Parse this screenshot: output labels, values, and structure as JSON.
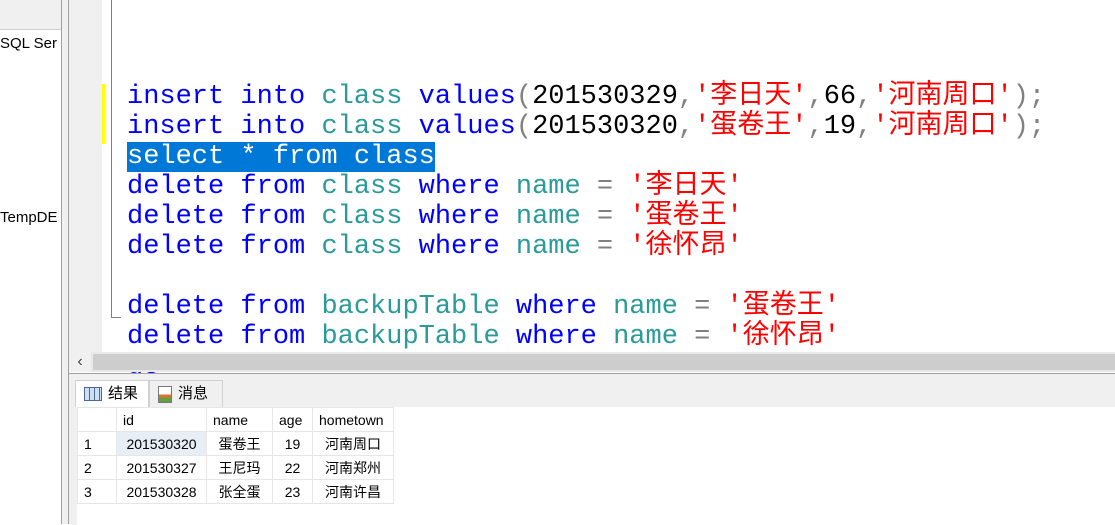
{
  "object_explorer": {
    "nodes": [
      "SQL Ser",
      "TempDE"
    ]
  },
  "editor": {
    "lines": [
      [],
      [
        {
          "t": "insert",
          "c": "kw"
        },
        {
          "t": " "
        },
        {
          "t": "into",
          "c": "kw"
        },
        {
          "t": " "
        },
        {
          "t": "class",
          "c": "id"
        },
        {
          "t": " "
        },
        {
          "t": "values",
          "c": "kw"
        },
        {
          "t": "(",
          "c": "pu"
        },
        {
          "t": "201530329",
          "c": "nu"
        },
        {
          "t": ",",
          "c": "pu"
        },
        {
          "t": "'李日天'",
          "c": "st"
        },
        {
          "t": ",",
          "c": "pu"
        },
        {
          "t": "66",
          "c": "nu"
        },
        {
          "t": ",",
          "c": "pu"
        },
        {
          "t": "'河南周口'",
          "c": "st"
        },
        {
          "t": ");",
          "c": "pu"
        }
      ],
      [
        {
          "t": "insert",
          "c": "kw"
        },
        {
          "t": " "
        },
        {
          "t": "into",
          "c": "kw"
        },
        {
          "t": " "
        },
        {
          "t": "class",
          "c": "id"
        },
        {
          "t": " "
        },
        {
          "t": "values",
          "c": "kw"
        },
        {
          "t": "(",
          "c": "pu"
        },
        {
          "t": "201530320",
          "c": "nu"
        },
        {
          "t": ",",
          "c": "pu"
        },
        {
          "t": "'蛋卷王'",
          "c": "st"
        },
        {
          "t": ",",
          "c": "pu"
        },
        {
          "t": "19",
          "c": "nu"
        },
        {
          "t": ",",
          "c": "pu"
        },
        {
          "t": "'河南周口'",
          "c": "st"
        },
        {
          "t": ");",
          "c": "pu"
        }
      ],
      [
        {
          "t": "select * from class",
          "c": "sel"
        }
      ],
      [
        {
          "t": "delete",
          "c": "kw"
        },
        {
          "t": " "
        },
        {
          "t": "from",
          "c": "kw"
        },
        {
          "t": " "
        },
        {
          "t": "class",
          "c": "id"
        },
        {
          "t": " "
        },
        {
          "t": "where",
          "c": "kw"
        },
        {
          "t": " "
        },
        {
          "t": "name",
          "c": "id"
        },
        {
          "t": " "
        },
        {
          "t": "=",
          "c": "pu"
        },
        {
          "t": " "
        },
        {
          "t": "'李日天'",
          "c": "st"
        }
      ],
      [
        {
          "t": "delete",
          "c": "kw"
        },
        {
          "t": " "
        },
        {
          "t": "from",
          "c": "kw"
        },
        {
          "t": " "
        },
        {
          "t": "class",
          "c": "id"
        },
        {
          "t": " "
        },
        {
          "t": "where",
          "c": "kw"
        },
        {
          "t": " "
        },
        {
          "t": "name",
          "c": "id"
        },
        {
          "t": " "
        },
        {
          "t": "=",
          "c": "pu"
        },
        {
          "t": " "
        },
        {
          "t": "'蛋卷王'",
          "c": "st"
        }
      ],
      [
        {
          "t": "delete",
          "c": "kw"
        },
        {
          "t": " "
        },
        {
          "t": "from",
          "c": "kw"
        },
        {
          "t": " "
        },
        {
          "t": "class",
          "c": "id"
        },
        {
          "t": " "
        },
        {
          "t": "where",
          "c": "kw"
        },
        {
          "t": " "
        },
        {
          "t": "name",
          "c": "id"
        },
        {
          "t": " "
        },
        {
          "t": "=",
          "c": "pu"
        },
        {
          "t": " "
        },
        {
          "t": "'徐怀昂'",
          "c": "st"
        }
      ],
      [],
      [
        {
          "t": "delete",
          "c": "kw"
        },
        {
          "t": " "
        },
        {
          "t": "from",
          "c": "kw"
        },
        {
          "t": " "
        },
        {
          "t": "backupTable",
          "c": "id"
        },
        {
          "t": " "
        },
        {
          "t": "where",
          "c": "kw"
        },
        {
          "t": " "
        },
        {
          "t": "name",
          "c": "id"
        },
        {
          "t": " "
        },
        {
          "t": "=",
          "c": "pu"
        },
        {
          "t": " "
        },
        {
          "t": "'蛋卷王'",
          "c": "st"
        }
      ],
      [
        {
          "t": "delete",
          "c": "kw"
        },
        {
          "t": " "
        },
        {
          "t": "from",
          "c": "kw"
        },
        {
          "t": " "
        },
        {
          "t": "backupTable",
          "c": "id"
        },
        {
          "t": " "
        },
        {
          "t": "where",
          "c": "kw"
        },
        {
          "t": " "
        },
        {
          "t": "name",
          "c": "id"
        },
        {
          "t": " "
        },
        {
          "t": "=",
          "c": "pu"
        },
        {
          "t": " "
        },
        {
          "t": "'徐怀昂'",
          "c": "st"
        }
      ],
      [
        {
          "t": "go",
          "c": "kw"
        }
      ]
    ]
  },
  "results": {
    "tabs": [
      {
        "label": "结果",
        "icon": "grid-icon"
      },
      {
        "label": "消息",
        "icon": "messages-icon"
      }
    ],
    "columns": [
      "",
      "id",
      "name",
      "age",
      "hometown"
    ],
    "rows": [
      [
        "1",
        "201530320",
        "蛋卷王",
        "19",
        "河南周口"
      ],
      [
        "2",
        "201530327",
        "王尼玛",
        "22",
        "河南郑州"
      ],
      [
        "3",
        "201530328",
        "张全蛋",
        "23",
        "河南许昌"
      ]
    ]
  },
  "colors": {
    "keyword": "#0000ff",
    "identifier": "#2a9a9a",
    "string": "#ff0000",
    "selection": "#0078d7"
  }
}
